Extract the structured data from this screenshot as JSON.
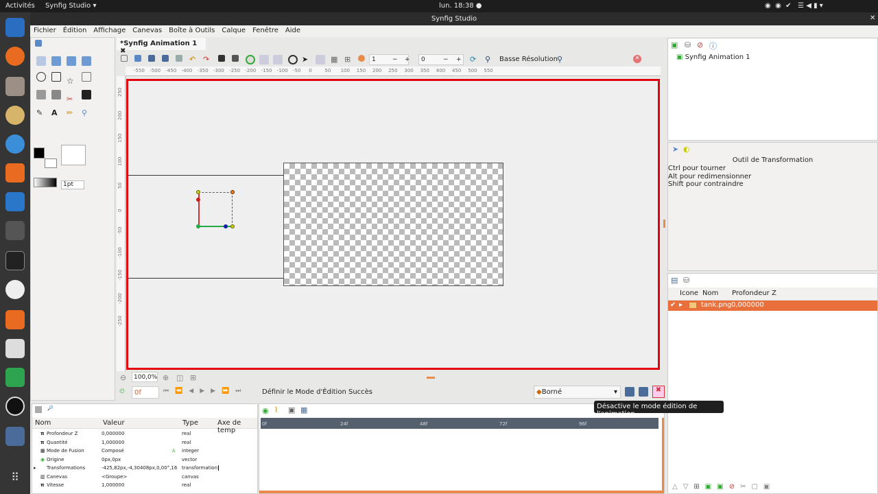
{
  "system": {
    "activities": "Activités",
    "app_menu": "Synfig Studio ▾",
    "clock": "lun. 18:38 ●"
  },
  "window": {
    "title": "Synfig Studio"
  },
  "menu": [
    "Fichier",
    "Édition",
    "Affichage",
    "Canevas",
    "Boîte à Outils",
    "Calque",
    "Fenêtre",
    "Aide"
  ],
  "toolbox": {
    "brush_size": "1pt"
  },
  "document": {
    "tab": "*Synfig Animation 1",
    "quality": "1",
    "lower_bound": "0",
    "resolution_label": "Basse Résolution"
  },
  "ruler_top": [
    "-550",
    "-500",
    "-450",
    "-400",
    "-350",
    "-300",
    "-250",
    "-200",
    "-150",
    "-100",
    "-50",
    "0",
    "50",
    "100",
    "150",
    "200",
    "250",
    "300",
    "350",
    "400",
    "450",
    "500",
    "550"
  ],
  "ruler_left": [
    "250",
    "200",
    "150",
    "100",
    "50",
    "0",
    "-50",
    "-100",
    "-150",
    "-200",
    "-250"
  ],
  "zoom": {
    "value": "100,0%"
  },
  "timebar": {
    "current_frame": "0f",
    "status": "Définir le Mode d'Édition Succès",
    "interpolation": "Borné"
  },
  "tooltip": "Désactive le mode édition de l'animation",
  "params": {
    "headers": [
      "Nom",
      "Valeur",
      "Type",
      "Axe de temp"
    ],
    "rows": [
      {
        "name": "Profondeur Z",
        "value": "0,000000",
        "type": "real"
      },
      {
        "name": "Quantité",
        "value": "1,000000",
        "type": "real"
      },
      {
        "name": "Mode de Fusion",
        "value": "Composé",
        "type": "integer"
      },
      {
        "name": "Origine",
        "value": "0px,0px",
        "type": "vector"
      },
      {
        "name": "Transformations",
        "value": "-425,82px,-4,30408px,0,00°,16",
        "type": "transformation"
      },
      {
        "name": "Canevas",
        "value": "<Groupe>",
        "type": "canvas"
      },
      {
        "name": "Vitesse",
        "value": "1,000000",
        "type": "real"
      }
    ]
  },
  "timetrack": {
    "labels": [
      "0f",
      "24f",
      "48f",
      "72f",
      "96f"
    ]
  },
  "canvas_browser": {
    "item": "Synfig Animation 1"
  },
  "tool_options": {
    "title": "Outil de Transformation",
    "lines": [
      "Ctrl pour tourner",
      "Alt pour redimensionner",
      "Shift pour contraindre"
    ]
  },
  "layers": {
    "headers": [
      "Icone",
      "Nom",
      "Profondeur Z"
    ],
    "rows": [
      {
        "name": "tank.png",
        "z": "0,000000"
      }
    ]
  }
}
